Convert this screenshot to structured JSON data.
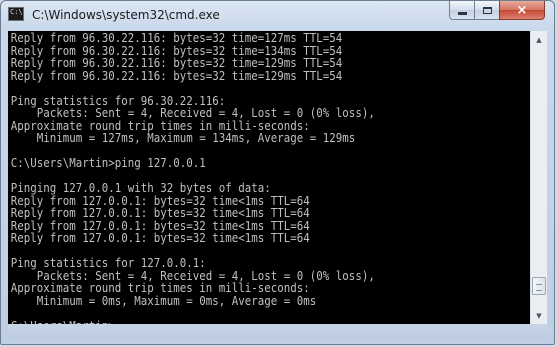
{
  "window": {
    "title": "C:\\Windows\\system32\\cmd.exe",
    "icon_text": "C:\\"
  },
  "caption_buttons": {
    "minimize": "minimize-icon",
    "maximize": "maximize-icon",
    "close": "×"
  },
  "console": {
    "lines": [
      "Reply from 96.30.22.116: bytes=32 time=127ms TTL=54",
      "Reply from 96.30.22.116: bytes=32 time=134ms TTL=54",
      "Reply from 96.30.22.116: bytes=32 time=129ms TTL=54",
      "Reply from 96.30.22.116: bytes=32 time=129ms TTL=54",
      "",
      "Ping statistics for 96.30.22.116:",
      "    Packets: Sent = 4, Received = 4, Lost = 0 (0% loss),",
      "Approximate round trip times in milli-seconds:",
      "    Minimum = 127ms, Maximum = 134ms, Average = 129ms",
      "",
      "C:\\Users\\Martin>ping 127.0.0.1",
      "",
      "Pinging 127.0.0.1 with 32 bytes of data:",
      "Reply from 127.0.0.1: bytes=32 time<1ms TTL=64",
      "Reply from 127.0.0.1: bytes=32 time<1ms TTL=64",
      "Reply from 127.0.0.1: bytes=32 time<1ms TTL=64",
      "Reply from 127.0.0.1: bytes=32 time<1ms TTL=64",
      "",
      "Ping statistics for 127.0.0.1:",
      "    Packets: Sent = 4, Received = 4, Lost = 0 (0% loss),",
      "Approximate round trip times in milli-seconds:",
      "    Minimum = 0ms, Maximum = 0ms, Average = 0ms",
      "",
      "C:\\Users\\Martin>"
    ]
  },
  "scrollbar": {
    "up_arrow": "▲",
    "down_arrow": "▼",
    "position": 0.95
  },
  "colors": {
    "console_background": "#000000",
    "console_text": "#c0c0c0",
    "close_button": "#c44a33"
  }
}
